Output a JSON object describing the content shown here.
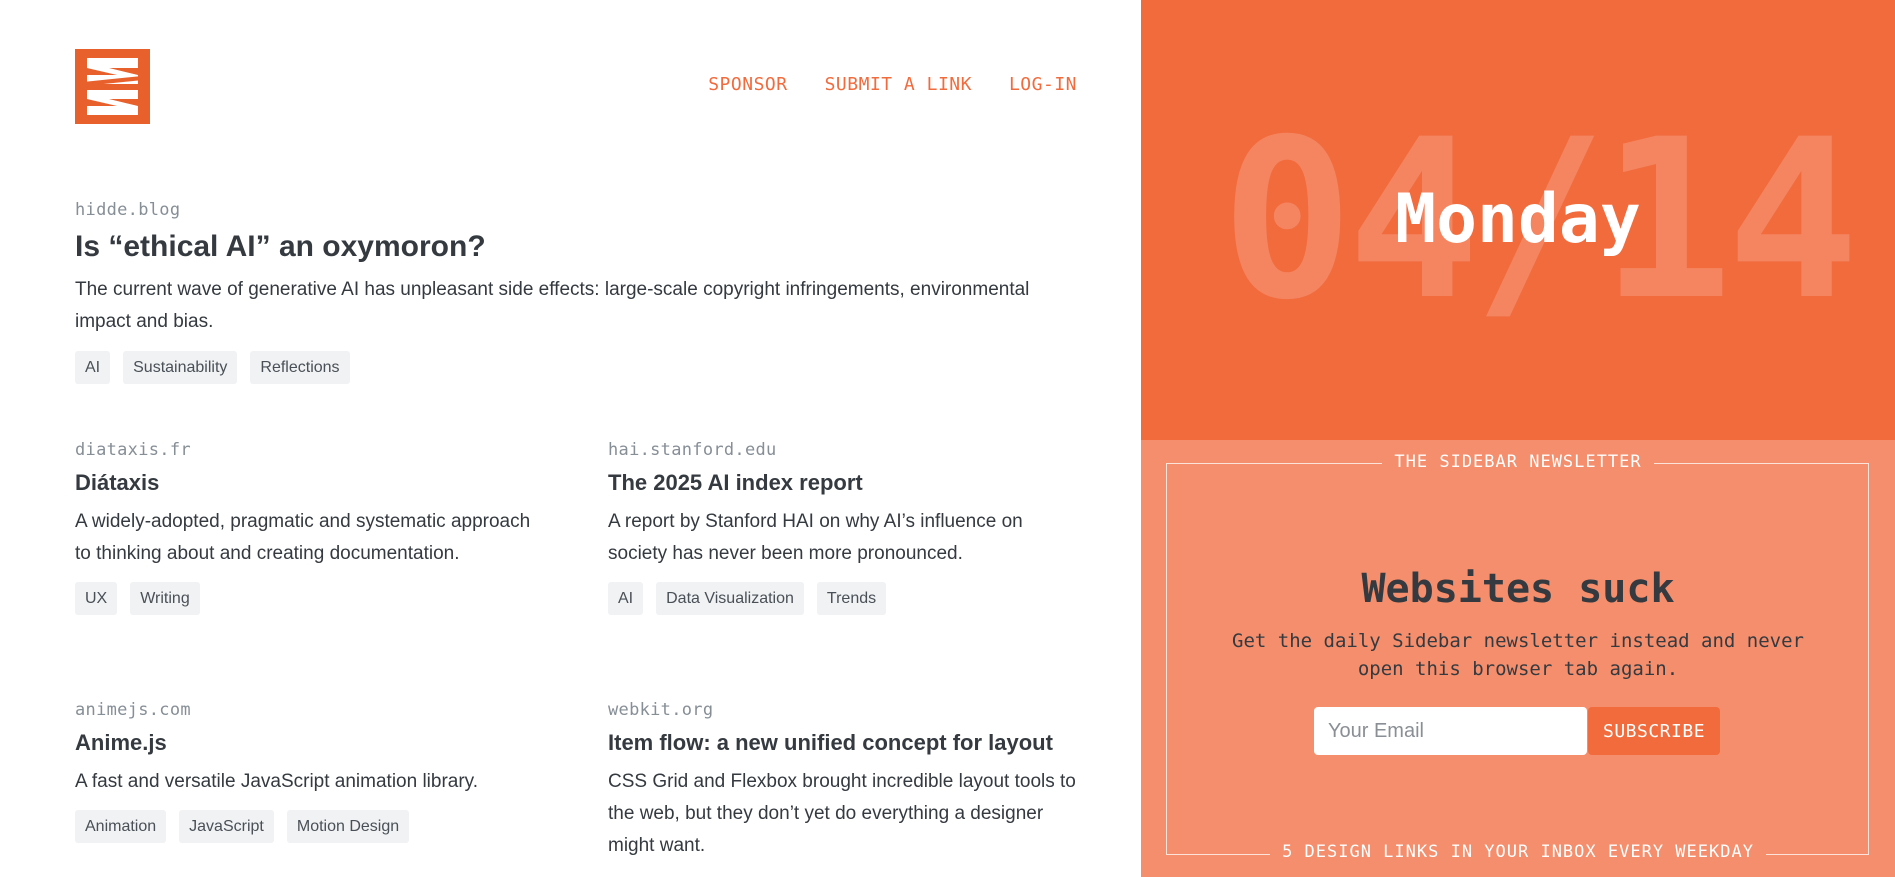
{
  "nav": {
    "logo_label": "Sidebar",
    "links": [
      "SPONSOR",
      "SUBMIT A LINK",
      "LOG-IN"
    ]
  },
  "featured": {
    "domain": "hidde.blog",
    "title": "Is “ethical AI” an oxymoron?",
    "description": "The current wave of generative AI has unpleasant side effects: large-scale copyright infringements, environmental impact and bias.",
    "tags": [
      "AI",
      "Sustainability",
      "Reflections"
    ]
  },
  "cards": [
    {
      "domain": "diataxis.fr",
      "title": "Diátaxis",
      "description": "A widely-adopted, pragmatic and systematic approach to thinking about and creating documentation.",
      "tags": [
        "UX",
        "Writing"
      ]
    },
    {
      "domain": "hai.stanford.edu",
      "title": "The 2025 AI index report",
      "description": "A report by Stanford HAI on why AI’s influence on society has never been more pronounced.",
      "tags": [
        "AI",
        "Data Visualization",
        "Trends"
      ]
    },
    {
      "domain": "animejs.com",
      "title": "Anime.js",
      "description": "A fast and versatile JavaScript animation library.",
      "tags": [
        "Animation",
        "JavaScript",
        "Motion Design"
      ]
    },
    {
      "domain": "webkit.org",
      "title": "Item flow: a new unified concept for layout",
      "description": "CSS Grid and Flexbox brought incredible layout tools to the web, but they don’t yet do everything a designer might want.",
      "tags": []
    }
  ],
  "date": {
    "numeric": "04/14",
    "day": "Monday"
  },
  "newsletter": {
    "label_top": "THE SIDEBAR NEWSLETTER",
    "heading": "Websites suck",
    "subtext": "Get the daily Sidebar newsletter instead and never open this browser tab again.",
    "email_placeholder": "Your Email",
    "button": "SUBSCRIBE",
    "label_bottom": "5 DESIGN LINKS IN YOUR INBOX EVERY WEEKDAY"
  },
  "colors": {
    "accent": "#f26b3d",
    "newsletter_bg": "#f48e6c",
    "tag_bg": "#f1f2f3"
  }
}
